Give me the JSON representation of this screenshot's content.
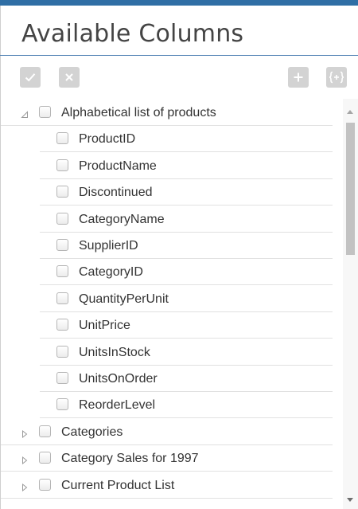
{
  "panel": {
    "title": "Available Columns",
    "accent_color": "#2f6ea5"
  },
  "toolbar": {
    "buttons": [
      {
        "name": "select-all",
        "icon": "check-icon"
      },
      {
        "name": "clear",
        "icon": "close-icon"
      },
      {
        "name": "add",
        "icon": "plus-icon"
      },
      {
        "name": "add-expression",
        "icon": "braces-plus-icon"
      }
    ]
  },
  "tree": {
    "groups": [
      {
        "label": "Alphabetical list of products",
        "expanded": true,
        "checked": false,
        "children": [
          {
            "label": "ProductID",
            "checked": false
          },
          {
            "label": "ProductName",
            "checked": false
          },
          {
            "label": "Discontinued",
            "checked": false
          },
          {
            "label": "CategoryName",
            "checked": false
          },
          {
            "label": "SupplierID",
            "checked": false
          },
          {
            "label": "CategoryID",
            "checked": false
          },
          {
            "label": "QuantityPerUnit",
            "checked": false
          },
          {
            "label": "UnitPrice",
            "checked": false
          },
          {
            "label": "UnitsInStock",
            "checked": false
          },
          {
            "label": "UnitsOnOrder",
            "checked": false
          },
          {
            "label": "ReorderLevel",
            "checked": false
          }
        ]
      },
      {
        "label": "Categories",
        "expanded": false,
        "checked": false,
        "children": []
      },
      {
        "label": "Category Sales for 1997",
        "expanded": false,
        "checked": false,
        "children": []
      },
      {
        "label": "Current Product List",
        "expanded": false,
        "checked": false,
        "children": []
      }
    ]
  }
}
